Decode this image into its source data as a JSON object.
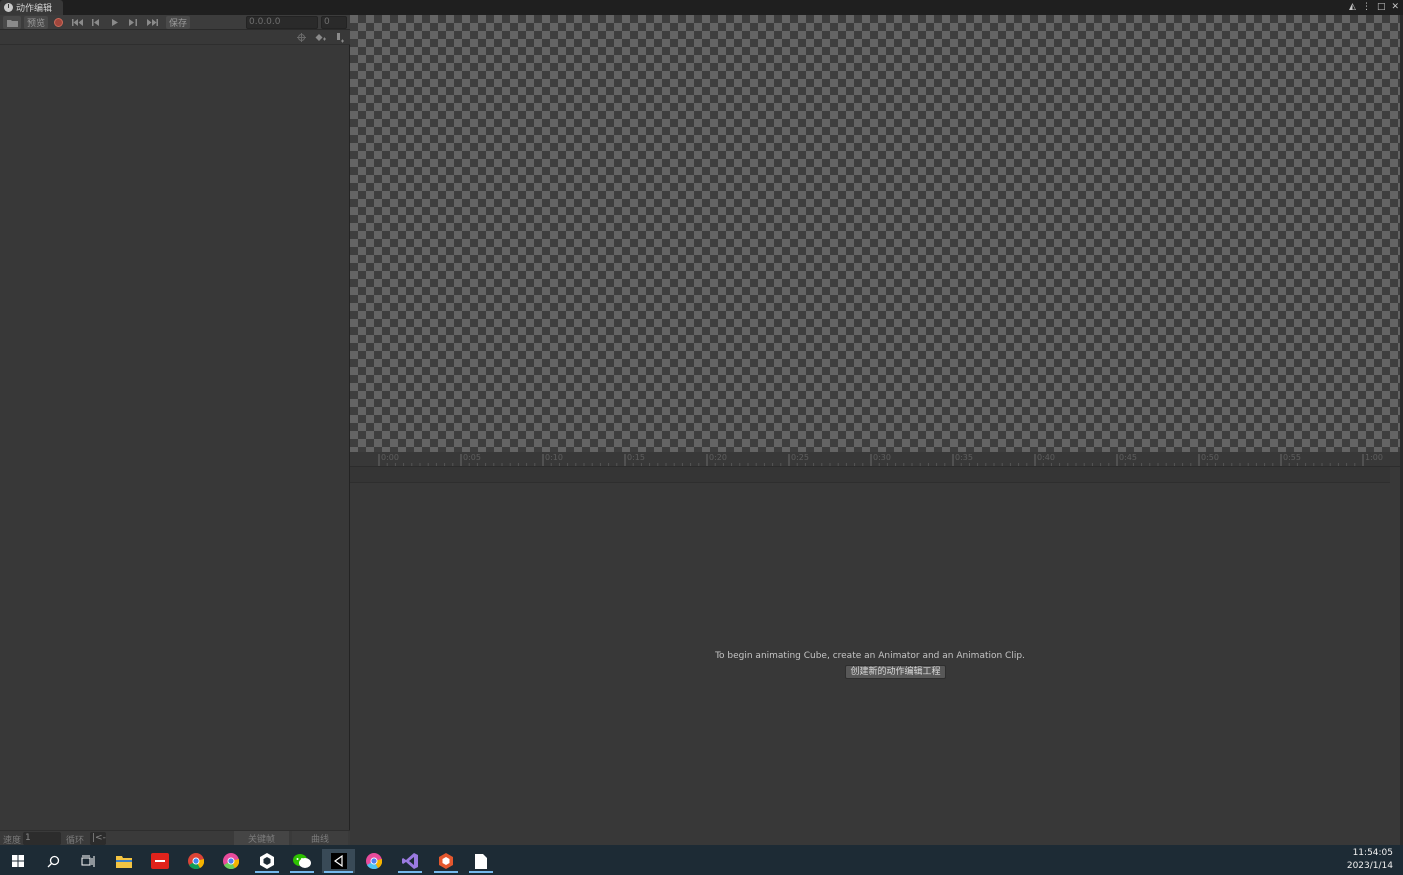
{
  "window": {
    "tab_title": "动作编辑",
    "controls": [
      "lock-icon",
      "more-icon",
      "maximize-icon",
      "close-icon"
    ]
  },
  "toolbar": {
    "preview_label": "预览",
    "save_label": "保存",
    "time_field": "0.0.0.0",
    "frame_field": "0"
  },
  "timeline": {
    "ticks": [
      "0:00",
      "0:05",
      "0:10",
      "0:15",
      "0:20",
      "0:25",
      "0:30",
      "0:35",
      "0:40",
      "0:45",
      "0:50",
      "0:55",
      "1:00"
    ]
  },
  "empty_state": {
    "message": "To begin animating Cube, create an Animator and an Animation Clip.",
    "create_button": "创建新的动作编辑工程"
  },
  "bottom_bar": {
    "speed_label": "速度",
    "speed_value": "1",
    "loop_label": "循环",
    "wrap_value": "|<-",
    "keyframes_tab": "关键帧",
    "curves_tab": "曲线"
  },
  "taskbar": {
    "icons": [
      "windows-start-icon",
      "search-icon",
      "task-view-icon",
      "file-explorer-icon",
      "app-red-icon",
      "chrome-icon",
      "chrome-alt-icon",
      "unity-icon",
      "wechat-icon",
      "unity-editor-icon",
      "chrome-canary-icon",
      "visual-studio-icon",
      "app-orange-icon",
      "notepad-icon"
    ],
    "time": "11:54:05",
    "date": "2023/1/14"
  }
}
